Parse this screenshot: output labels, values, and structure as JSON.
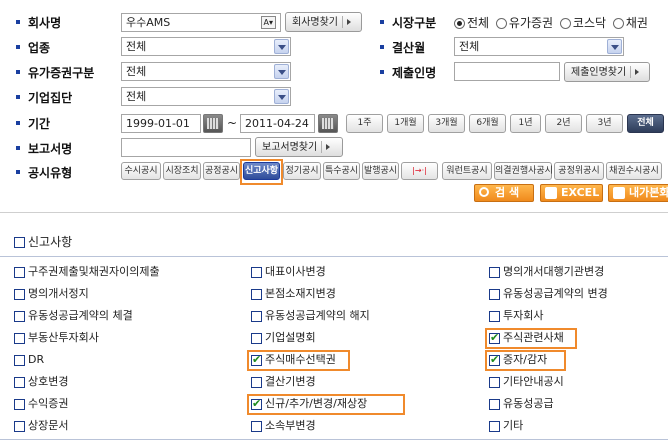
{
  "form": {
    "company_label": "회사명",
    "company_value": "우수AMS",
    "company_ac_badge": "A",
    "company_search_btn": "회사명찾기",
    "market_label": "시장구분",
    "market_options": [
      "전체",
      "유가증권",
      "코스닥",
      "채권"
    ],
    "market_selected": "전체",
    "industry_label": "업종",
    "industry_value": "전체",
    "fiscal_label": "결산월",
    "fiscal_value": "전체",
    "security_type_label": "유가증권구분",
    "security_type_value": "전체",
    "submitter_label": "제출인명",
    "submitter_value": "",
    "submitter_search_btn": "제출인명찾기",
    "corp_group_label": "기업집단",
    "corp_group_value": "전체",
    "period_label": "기간",
    "date_from": "1999-01-01",
    "date_sep": "~",
    "date_to": "2011-04-24",
    "period_buttons": [
      "1주",
      "1개월",
      "3개월",
      "6개월",
      "1년",
      "2년",
      "3년",
      "전체"
    ],
    "period_active": "전체",
    "report_label": "보고서명",
    "report_value": "",
    "report_search_btn": "보고서명찾기",
    "disclosure_label": "공시유형",
    "disclosure_types": [
      "수시공시",
      "시장조치",
      "공정공시",
      "신고사항",
      "정기공시",
      "특수공시",
      "발행공시",
      "",
      "워런트공시",
      "의결권행사공시",
      "공정위공시",
      "채권수시공시"
    ],
    "disclosure_selected": "신고사항",
    "search_btn": "검 색",
    "excel_btn": "EXCEL",
    "mydisclosure_btn": "내가본화"
  },
  "notify": {
    "header": "신고사항",
    "header_checked": false,
    "columns": [
      [
        {
          "label": "구주권제출및채권자이의제출",
          "checked": false
        },
        {
          "label": "명의개서정지",
          "checked": false
        },
        {
          "label": "유동성공급계약의 체결",
          "checked": false
        },
        {
          "label": "부동산투자회사",
          "checked": false
        },
        {
          "label": "DR",
          "checked": false
        },
        {
          "label": "상호변경",
          "checked": false
        },
        {
          "label": "수익증권",
          "checked": false
        },
        {
          "label": "상장문서",
          "checked": false
        }
      ],
      [
        {
          "label": "대표이사변경",
          "checked": false
        },
        {
          "label": "본점소재지변경",
          "checked": false
        },
        {
          "label": "유동성공급계약의 해지",
          "checked": false
        },
        {
          "label": "기업설명회",
          "checked": false
        },
        {
          "label": "주식매수선택권",
          "checked": true
        },
        {
          "label": "결산기변경",
          "checked": false
        },
        {
          "label": "신규/추가/변경/재상장",
          "checked": true
        },
        {
          "label": "소속부변경",
          "checked": false
        }
      ],
      [
        {
          "label": "명의개서대행기관변경",
          "checked": false
        },
        {
          "label": "유동성공급계약의 변경",
          "checked": false
        },
        {
          "label": "투자회사",
          "checked": false
        },
        {
          "label": "주식관련사채",
          "checked": true
        },
        {
          "label": "증자/감자",
          "checked": true
        },
        {
          "label": "기타안내공시",
          "checked": false
        },
        {
          "label": "유동성공급",
          "checked": false
        },
        {
          "label": "기타",
          "checked": false
        }
      ]
    ]
  },
  "colors": {
    "accent_orange": "#f08a2c",
    "bullet_blue": "#1a3fa0",
    "selected_blue": "#2f4c9a"
  }
}
